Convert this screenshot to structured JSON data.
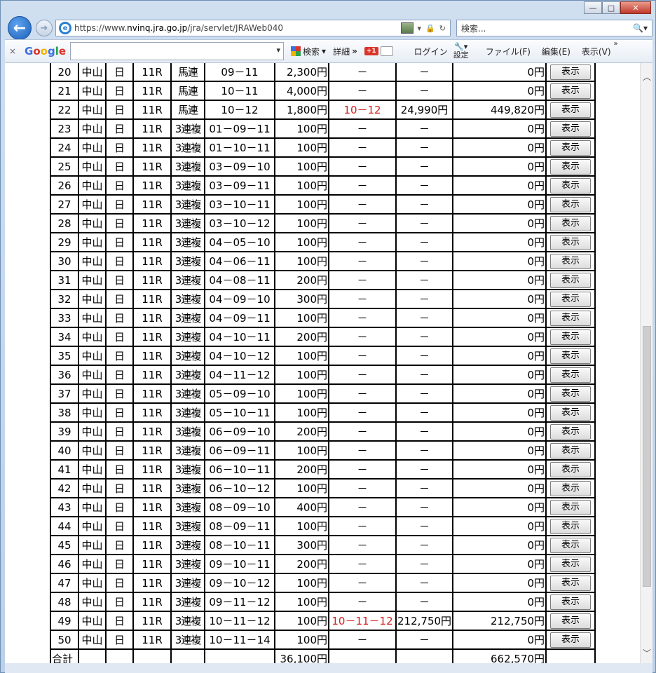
{
  "window": {
    "minimize": "—",
    "maximize": "□",
    "close": "✕"
  },
  "browser": {
    "url_prefix": "https://www.",
    "url_host": "nvinq.jra.go.jp",
    "url_path": "/jra/servlet/JRAWeb040",
    "search_placeholder": "検索...",
    "search_icon": "🔍▾"
  },
  "google_toolbar": {
    "close": "×",
    "logo": [
      "G",
      "o",
      "o",
      "g",
      "l",
      "e"
    ],
    "search_label": "検索",
    "detail": "詳細",
    "more": "»",
    "plus_one": "+1",
    "login": "ログイン",
    "settings": "設定",
    "menu_file": "ファイル(F)",
    "menu_edit": "編集(E)",
    "menu_view": "表示(V)",
    "overflow": "»"
  },
  "table": {
    "rows": [
      {
        "no": "20",
        "place": "中山",
        "day": "日",
        "race": "11R",
        "type": "馬連",
        "combo": "09－11",
        "amount": "2,300円",
        "hit": "－",
        "payout": "－",
        "ret": "0円",
        "btn": "表示",
        "hit_red": false
      },
      {
        "no": "21",
        "place": "中山",
        "day": "日",
        "race": "11R",
        "type": "馬連",
        "combo": "10－11",
        "amount": "4,000円",
        "hit": "－",
        "payout": "－",
        "ret": "0円",
        "btn": "表示",
        "hit_red": false
      },
      {
        "no": "22",
        "place": "中山",
        "day": "日",
        "race": "11R",
        "type": "馬連",
        "combo": "10－12",
        "amount": "1,800円",
        "hit": "10－12",
        "payout": "24,990円",
        "ret": "449,820円",
        "btn": "表示",
        "hit_red": true
      },
      {
        "no": "23",
        "place": "中山",
        "day": "日",
        "race": "11R",
        "type": "3連複",
        "combo": "01－09－11",
        "amount": "100円",
        "hit": "－",
        "payout": "－",
        "ret": "0円",
        "btn": "表示",
        "hit_red": false
      },
      {
        "no": "24",
        "place": "中山",
        "day": "日",
        "race": "11R",
        "type": "3連複",
        "combo": "01－10－11",
        "amount": "100円",
        "hit": "－",
        "payout": "－",
        "ret": "0円",
        "btn": "表示",
        "hit_red": false
      },
      {
        "no": "25",
        "place": "中山",
        "day": "日",
        "race": "11R",
        "type": "3連複",
        "combo": "03－09－10",
        "amount": "100円",
        "hit": "－",
        "payout": "－",
        "ret": "0円",
        "btn": "表示",
        "hit_red": false
      },
      {
        "no": "26",
        "place": "中山",
        "day": "日",
        "race": "11R",
        "type": "3連複",
        "combo": "03－09－11",
        "amount": "100円",
        "hit": "－",
        "payout": "－",
        "ret": "0円",
        "btn": "表示",
        "hit_red": false
      },
      {
        "no": "27",
        "place": "中山",
        "day": "日",
        "race": "11R",
        "type": "3連複",
        "combo": "03－10－11",
        "amount": "100円",
        "hit": "－",
        "payout": "－",
        "ret": "0円",
        "btn": "表示",
        "hit_red": false
      },
      {
        "no": "28",
        "place": "中山",
        "day": "日",
        "race": "11R",
        "type": "3連複",
        "combo": "03－10－12",
        "amount": "100円",
        "hit": "－",
        "payout": "－",
        "ret": "0円",
        "btn": "表示",
        "hit_red": false
      },
      {
        "no": "29",
        "place": "中山",
        "day": "日",
        "race": "11R",
        "type": "3連複",
        "combo": "04－05－10",
        "amount": "100円",
        "hit": "－",
        "payout": "－",
        "ret": "0円",
        "btn": "表示",
        "hit_red": false
      },
      {
        "no": "30",
        "place": "中山",
        "day": "日",
        "race": "11R",
        "type": "3連複",
        "combo": "04－06－11",
        "amount": "100円",
        "hit": "－",
        "payout": "－",
        "ret": "0円",
        "btn": "表示",
        "hit_red": false
      },
      {
        "no": "31",
        "place": "中山",
        "day": "日",
        "race": "11R",
        "type": "3連複",
        "combo": "04－08－11",
        "amount": "200円",
        "hit": "－",
        "payout": "－",
        "ret": "0円",
        "btn": "表示",
        "hit_red": false
      },
      {
        "no": "32",
        "place": "中山",
        "day": "日",
        "race": "11R",
        "type": "3連複",
        "combo": "04－09－10",
        "amount": "300円",
        "hit": "－",
        "payout": "－",
        "ret": "0円",
        "btn": "表示",
        "hit_red": false
      },
      {
        "no": "33",
        "place": "中山",
        "day": "日",
        "race": "11R",
        "type": "3連複",
        "combo": "04－09－11",
        "amount": "100円",
        "hit": "－",
        "payout": "－",
        "ret": "0円",
        "btn": "表示",
        "hit_red": false
      },
      {
        "no": "34",
        "place": "中山",
        "day": "日",
        "race": "11R",
        "type": "3連複",
        "combo": "04－10－11",
        "amount": "200円",
        "hit": "－",
        "payout": "－",
        "ret": "0円",
        "btn": "表示",
        "hit_red": false
      },
      {
        "no": "35",
        "place": "中山",
        "day": "日",
        "race": "11R",
        "type": "3連複",
        "combo": "04－10－12",
        "amount": "100円",
        "hit": "－",
        "payout": "－",
        "ret": "0円",
        "btn": "表示",
        "hit_red": false
      },
      {
        "no": "36",
        "place": "中山",
        "day": "日",
        "race": "11R",
        "type": "3連複",
        "combo": "04－11－12",
        "amount": "100円",
        "hit": "－",
        "payout": "－",
        "ret": "0円",
        "btn": "表示",
        "hit_red": false
      },
      {
        "no": "37",
        "place": "中山",
        "day": "日",
        "race": "11R",
        "type": "3連複",
        "combo": "05－09－10",
        "amount": "100円",
        "hit": "－",
        "payout": "－",
        "ret": "0円",
        "btn": "表示",
        "hit_red": false
      },
      {
        "no": "38",
        "place": "中山",
        "day": "日",
        "race": "11R",
        "type": "3連複",
        "combo": "05－10－11",
        "amount": "100円",
        "hit": "－",
        "payout": "－",
        "ret": "0円",
        "btn": "表示",
        "hit_red": false
      },
      {
        "no": "39",
        "place": "中山",
        "day": "日",
        "race": "11R",
        "type": "3連複",
        "combo": "06－09－10",
        "amount": "200円",
        "hit": "－",
        "payout": "－",
        "ret": "0円",
        "btn": "表示",
        "hit_red": false
      },
      {
        "no": "40",
        "place": "中山",
        "day": "日",
        "race": "11R",
        "type": "3連複",
        "combo": "06－09－11",
        "amount": "100円",
        "hit": "－",
        "payout": "－",
        "ret": "0円",
        "btn": "表示",
        "hit_red": false
      },
      {
        "no": "41",
        "place": "中山",
        "day": "日",
        "race": "11R",
        "type": "3連複",
        "combo": "06－10－11",
        "amount": "200円",
        "hit": "－",
        "payout": "－",
        "ret": "0円",
        "btn": "表示",
        "hit_red": false
      },
      {
        "no": "42",
        "place": "中山",
        "day": "日",
        "race": "11R",
        "type": "3連複",
        "combo": "06－10－12",
        "amount": "100円",
        "hit": "－",
        "payout": "－",
        "ret": "0円",
        "btn": "表示",
        "hit_red": false
      },
      {
        "no": "43",
        "place": "中山",
        "day": "日",
        "race": "11R",
        "type": "3連複",
        "combo": "08－09－10",
        "amount": "400円",
        "hit": "－",
        "payout": "－",
        "ret": "0円",
        "btn": "表示",
        "hit_red": false
      },
      {
        "no": "44",
        "place": "中山",
        "day": "日",
        "race": "11R",
        "type": "3連複",
        "combo": "08－09－11",
        "amount": "100円",
        "hit": "－",
        "payout": "－",
        "ret": "0円",
        "btn": "表示",
        "hit_red": false
      },
      {
        "no": "45",
        "place": "中山",
        "day": "日",
        "race": "11R",
        "type": "3連複",
        "combo": "08－10－11",
        "amount": "300円",
        "hit": "－",
        "payout": "－",
        "ret": "0円",
        "btn": "表示",
        "hit_red": false
      },
      {
        "no": "46",
        "place": "中山",
        "day": "日",
        "race": "11R",
        "type": "3連複",
        "combo": "09－10－11",
        "amount": "200円",
        "hit": "－",
        "payout": "－",
        "ret": "0円",
        "btn": "表示",
        "hit_red": false
      },
      {
        "no": "47",
        "place": "中山",
        "day": "日",
        "race": "11R",
        "type": "3連複",
        "combo": "09－10－12",
        "amount": "100円",
        "hit": "－",
        "payout": "－",
        "ret": "0円",
        "btn": "表示",
        "hit_red": false
      },
      {
        "no": "48",
        "place": "中山",
        "day": "日",
        "race": "11R",
        "type": "3連複",
        "combo": "09－11－12",
        "amount": "100円",
        "hit": "－",
        "payout": "－",
        "ret": "0円",
        "btn": "表示",
        "hit_red": false
      },
      {
        "no": "49",
        "place": "中山",
        "day": "日",
        "race": "11R",
        "type": "3連複",
        "combo": "10－11－12",
        "amount": "100円",
        "hit": "10－11－12",
        "payout": "212,750円",
        "ret": "212,750円",
        "btn": "表示",
        "hit_red": true
      },
      {
        "no": "50",
        "place": "中山",
        "day": "日",
        "race": "11R",
        "type": "3連複",
        "combo": "10－11－14",
        "amount": "100円",
        "hit": "－",
        "payout": "－",
        "ret": "0円",
        "btn": "表示",
        "hit_red": false
      }
    ],
    "total": {
      "label": "合計",
      "amount": "36,100円",
      "ret": "662,570円"
    }
  },
  "colors": {
    "hit": "#d62020"
  }
}
